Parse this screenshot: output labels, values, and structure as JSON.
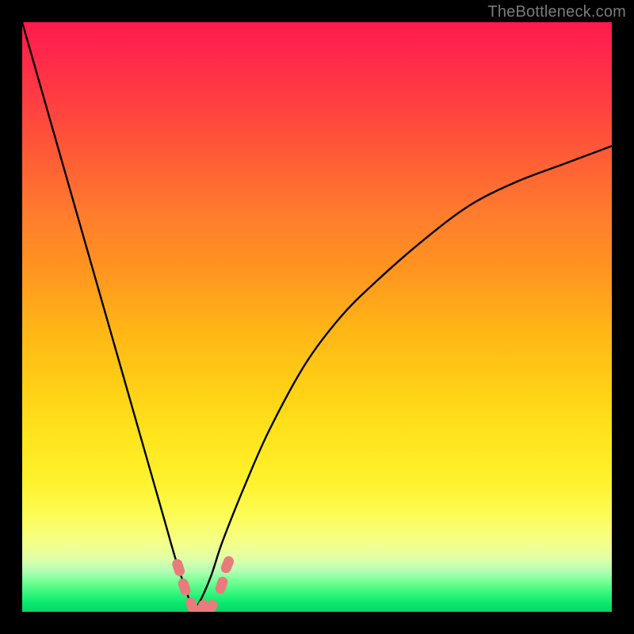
{
  "watermark": "TheBottleneck.com",
  "colors": {
    "background": "#000000",
    "curve": "#000000",
    "marker": "#e87c7c",
    "gradient_top": "#ff1a4d",
    "gradient_bottom": "#03d766"
  },
  "chart_data": {
    "type": "line",
    "title": "",
    "xlabel": "",
    "ylabel": "",
    "xlim": [
      0,
      100
    ],
    "ylim": [
      0,
      100
    ],
    "grid": false,
    "legend": false,
    "note": "No axis ticks or labels are shown in the image; x and y are normalized 0–100. Curve falls from top-left to a minimum near x≈29 then rises with decreasing slope toward the right edge (~y≈79 at x=100). Values estimated from pixel positions.",
    "series": [
      {
        "name": "bottleneck-curve",
        "x": [
          0,
          4,
          8,
          12,
          16,
          20,
          24,
          26,
          28,
          29,
          30,
          32,
          34,
          38,
          42,
          48,
          54,
          60,
          68,
          76,
          84,
          92,
          100
        ],
        "y": [
          100,
          86,
          72,
          58,
          44,
          30,
          16,
          9,
          3,
          0.5,
          1.5,
          6,
          12,
          22,
          31,
          42,
          50,
          56,
          63,
          69,
          73,
          76,
          79
        ]
      }
    ],
    "markers": [
      {
        "name": "marker-left-upper",
        "x": 26.5,
        "y": 7.5
      },
      {
        "name": "marker-left-mid",
        "x": 27.5,
        "y": 4.2
      },
      {
        "name": "marker-bottom-1",
        "x": 28.8,
        "y": 1.0
      },
      {
        "name": "marker-bottom-2",
        "x": 30.5,
        "y": 0.6
      },
      {
        "name": "marker-bottom-3",
        "x": 32.0,
        "y": 0.6
      },
      {
        "name": "marker-right-mid",
        "x": 33.8,
        "y": 4.5
      },
      {
        "name": "marker-right-upper",
        "x": 34.8,
        "y": 8.0
      }
    ]
  }
}
